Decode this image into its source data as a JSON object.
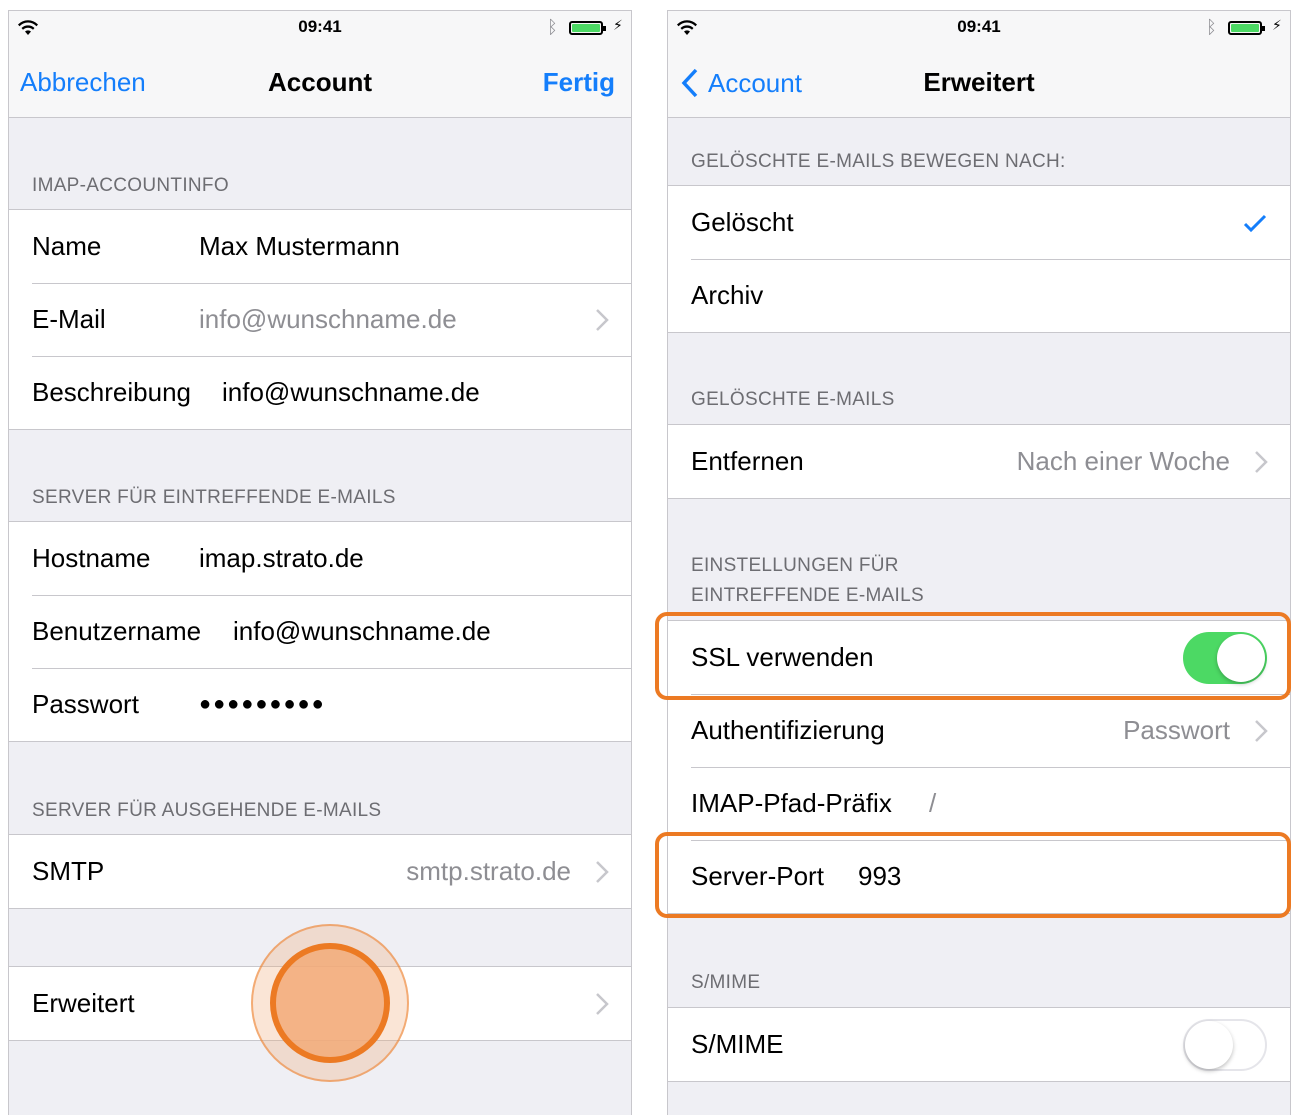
{
  "left_screen": {
    "status": {
      "time": "09:41"
    },
    "nav": {
      "cancel": "Abbrechen",
      "title": "Account",
      "done": "Fertig"
    },
    "imap_section": {
      "header": "IMAP-ACCOUNTINFO",
      "rows": [
        {
          "label": "Name",
          "value": "Max Mustermann"
        },
        {
          "label": "E-Mail",
          "value": "info@wunschname.de"
        },
        {
          "label": "Beschreibung",
          "value": "info@wunschname.de"
        }
      ]
    },
    "incoming_section": {
      "header": "SERVER FÜR EINTREFFENDE E-MAILS",
      "rows": [
        {
          "label": "Hostname",
          "value": "imap.strato.de"
        },
        {
          "label": "Benutzername",
          "value": "info@wunschname.de"
        },
        {
          "label": "Passwort",
          "value": "●●●●●●●●●"
        }
      ]
    },
    "outgoing_section": {
      "header": "SERVER FÜR AUSGEHENDE E-MAILS",
      "rows": [
        {
          "label": "SMTP",
          "value": "smtp.strato.de"
        }
      ]
    },
    "advanced_row": {
      "label": "Erweitert"
    }
  },
  "right_screen": {
    "status": {
      "time": "09:41"
    },
    "nav": {
      "back": "Account",
      "title": "Erweitert"
    },
    "move_section": {
      "header": "GELÖSCHTE E-MAILS BEWEGEN NACH:",
      "rows": [
        {
          "label": "Gelöscht",
          "selected": true
        },
        {
          "label": "Archiv",
          "selected": false
        }
      ]
    },
    "deleted_section": {
      "header": "GELÖSCHTE E-MAILS",
      "rows": [
        {
          "label": "Entfernen",
          "value": "Nach einer Woche"
        }
      ]
    },
    "incoming_settings_section": {
      "header_line1": "EINSTELLUNGEN FÜR",
      "header_line2": "EINTREFFENDE E-MAILS",
      "ssl": {
        "label": "SSL verwenden",
        "enabled": true
      },
      "auth": {
        "label": "Authentifizierung",
        "value": "Passwort"
      },
      "imap_prefix": {
        "label": "IMAP-Pfad-Präfix",
        "value": "/"
      },
      "server_port": {
        "label": "Server-Port",
        "value": "993"
      }
    },
    "smime_section": {
      "header": "S/MIME",
      "smime": {
        "label": "S/MIME",
        "enabled": false
      }
    }
  },
  "colors": {
    "tint": "#147efb",
    "switch_on": "#4cd964",
    "highlight": "#ec7a23",
    "background": "#efeff4"
  },
  "icons": [
    "wifi-icon",
    "bluetooth-icon",
    "battery-icon",
    "chevron-right-icon",
    "checkmark-icon",
    "back-chevron-icon"
  ]
}
